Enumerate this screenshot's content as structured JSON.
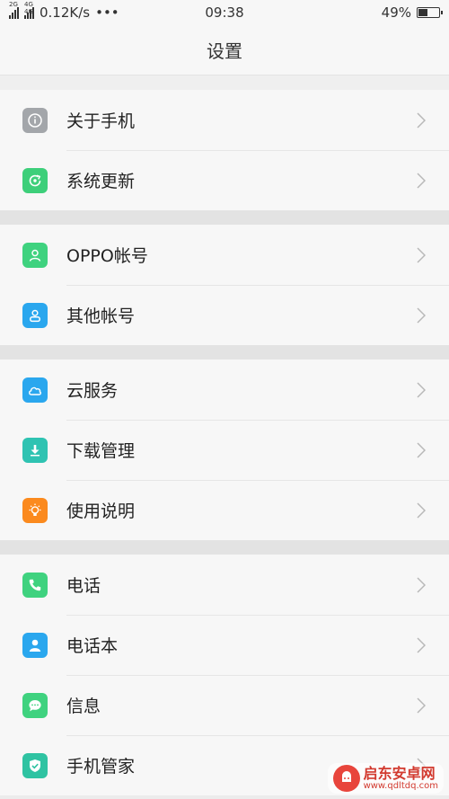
{
  "status_bar": {
    "net_tag_1": "2G",
    "net_tag_2": "4G 4G",
    "speed": "0.12K/s",
    "more": "•••",
    "time": "09:38",
    "battery_text": "49%",
    "battery_level": 0.49
  },
  "header": {
    "title": "设置"
  },
  "groups": [
    {
      "items": [
        {
          "label": "关于手机",
          "icon": "info-icon",
          "color": "#a3a6aa"
        },
        {
          "label": "系统更新",
          "icon": "update-icon",
          "color": "#3dcf7a"
        }
      ]
    },
    {
      "items": [
        {
          "label": "OPPO帐号",
          "icon": "account-icon",
          "color": "#3fd27f"
        },
        {
          "label": "其他帐号",
          "icon": "other-account-icon",
          "color": "#2aa7ee"
        }
      ]
    },
    {
      "items": [
        {
          "label": "云服务",
          "icon": "cloud-icon",
          "color": "#2aa7ee"
        },
        {
          "label": "下载管理",
          "icon": "download-icon",
          "color": "#2fc3b2"
        },
        {
          "label": "使用说明",
          "icon": "bulb-icon",
          "color": "#fb8a1e"
        }
      ]
    },
    {
      "items": [
        {
          "label": "电话",
          "icon": "phone-icon",
          "color": "#3fd27f"
        },
        {
          "label": "电话本",
          "icon": "contacts-icon",
          "color": "#2aa7ee"
        },
        {
          "label": "信息",
          "icon": "message-icon",
          "color": "#3fd27f"
        },
        {
          "label": "手机管家",
          "icon": "shield-icon",
          "color": "#2fc3a2"
        }
      ]
    }
  ],
  "watermark": {
    "title": "启东安卓网",
    "url": "www.qdltdq.com"
  }
}
